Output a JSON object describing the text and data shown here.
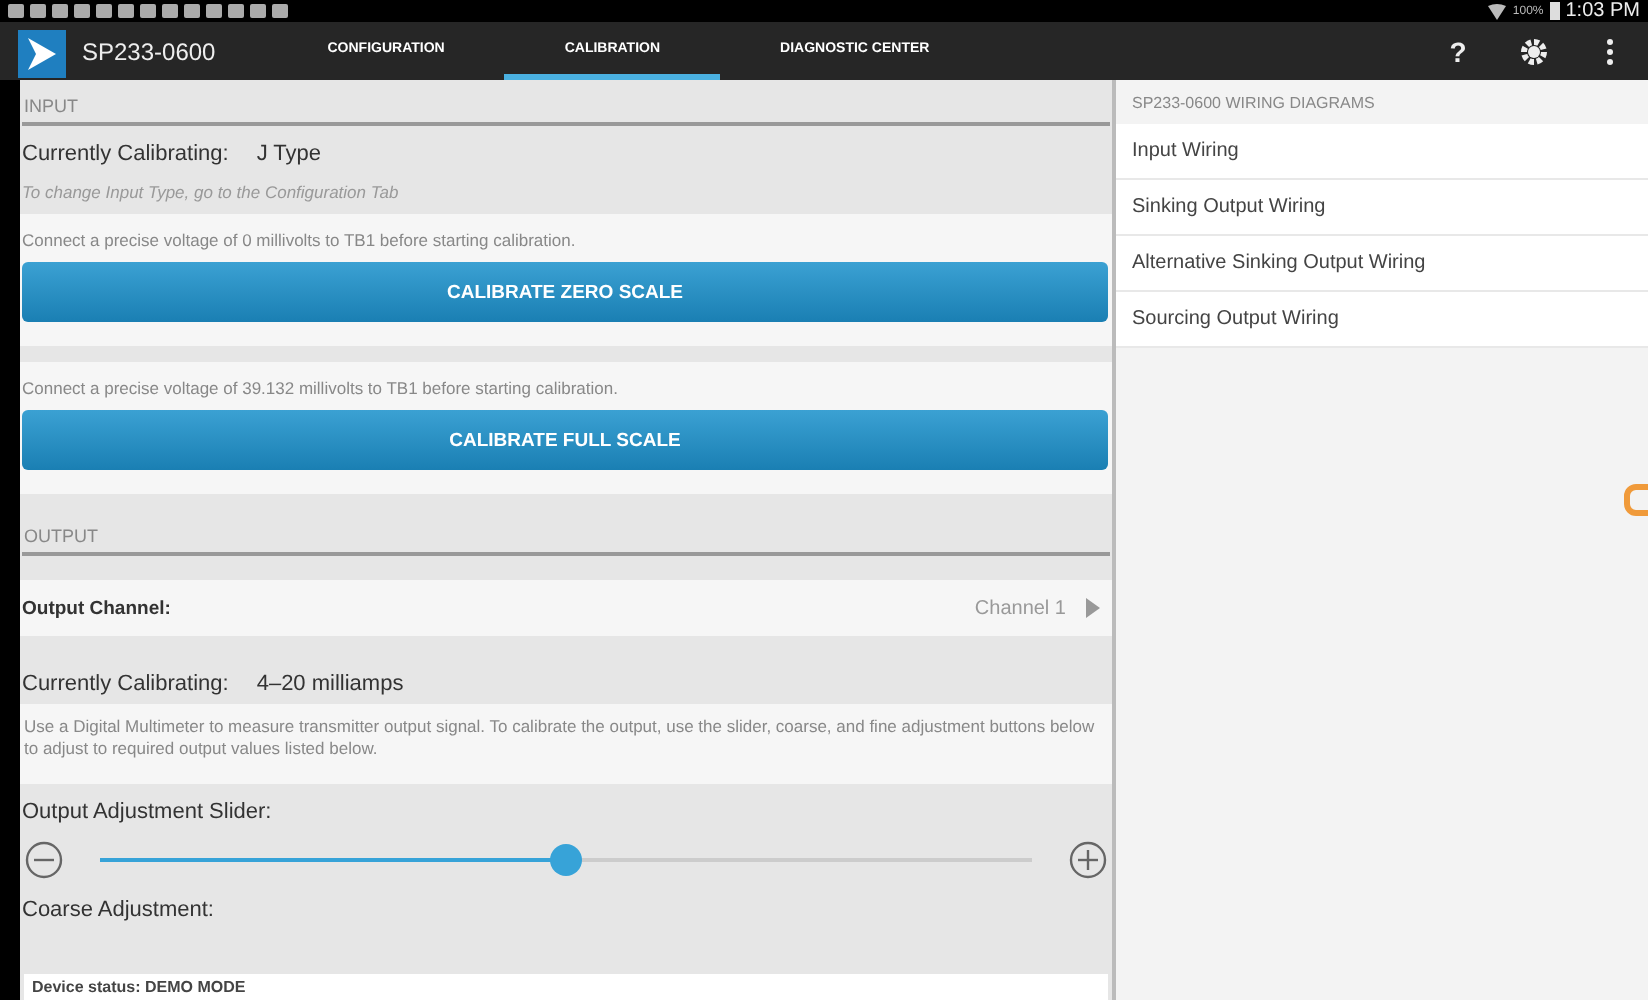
{
  "status_bar": {
    "battery_percent": "100%",
    "time": "1:03 PM"
  },
  "app_bar": {
    "title": "SP233-0600",
    "tabs": [
      {
        "label": "CONFIGURATION",
        "selected": false
      },
      {
        "label": "CALIBRATION",
        "selected": true
      },
      {
        "label": "DIAGNOSTIC CENTER",
        "selected": false
      }
    ],
    "help": "?"
  },
  "input": {
    "header": "INPUT",
    "calibrating_label": "Currently Calibrating:",
    "calibrating_value": "J Type",
    "hint": "To change Input Type, go to the Configuration Tab",
    "steps": [
      {
        "instruction": "Connect a precise voltage of 0 millivolts to TB1 before starting calibration.",
        "button": "CALIBRATE ZERO SCALE"
      },
      {
        "instruction": "Connect a precise voltage of 39.132 millivolts to TB1 before starting calibration.",
        "button": "CALIBRATE FULL SCALE"
      }
    ]
  },
  "output": {
    "header": "OUTPUT",
    "channel_label": "Output Channel:",
    "channel_value": "Channel 1",
    "calibrating_label": "Currently Calibrating:",
    "calibrating_value": "4–20 milliamps",
    "description": "Use a Digital Multimeter to measure transmitter output signal. To calibrate the output, use the slider, coarse, and fine adjustment buttons below to adjust to required output values listed below.",
    "slider_label": "Output Adjustment Slider:",
    "slider": {
      "level": 0.5
    },
    "coarse_label": "Coarse Adjustment:"
  },
  "device_status": "Device status:  DEMO MODE",
  "wiring": {
    "header": "SP233-0600 WIRING DIAGRAMS",
    "items": [
      "Input Wiring",
      "Sinking Output Wiring",
      "Alternative Sinking Output Wiring",
      "Sourcing Output Wiring"
    ]
  }
}
